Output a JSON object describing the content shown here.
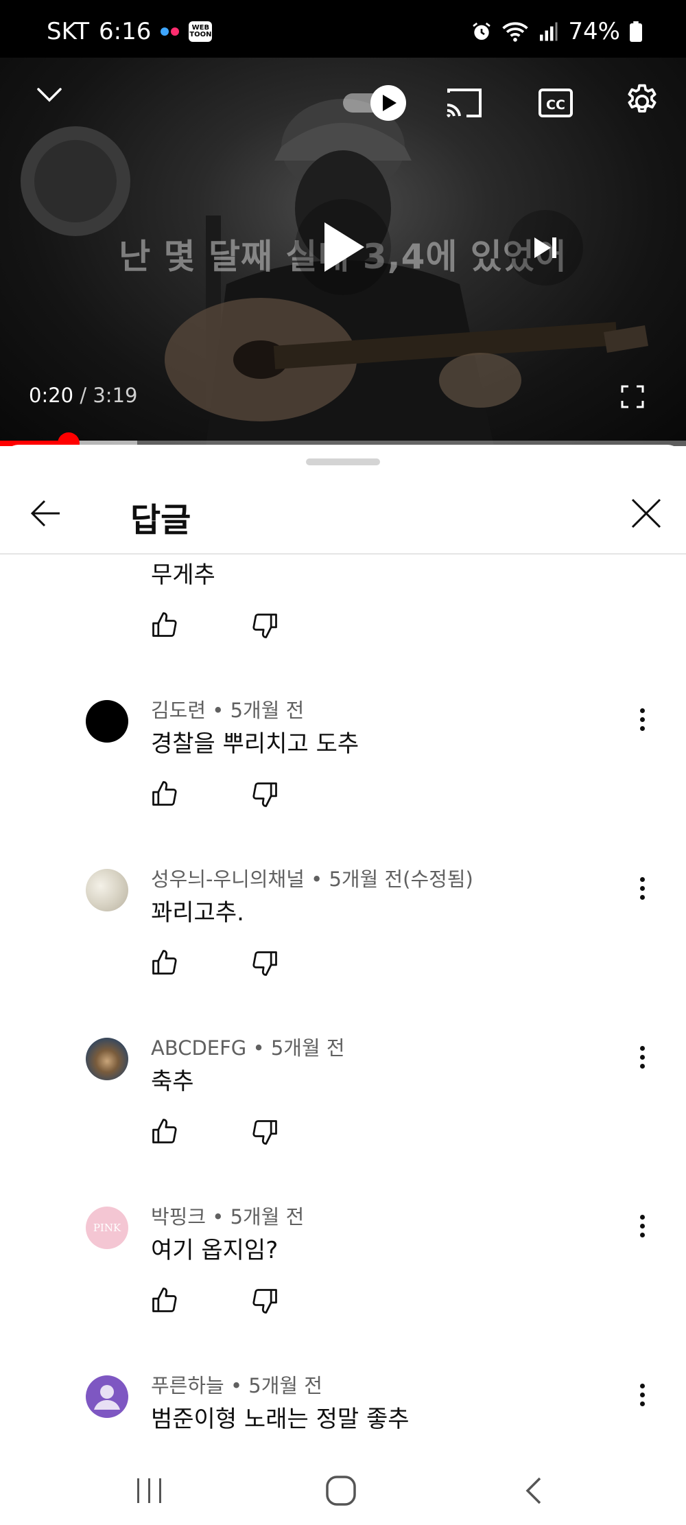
{
  "status_bar": {
    "carrier": "SKT",
    "time": "6:16",
    "battery": "74%",
    "icons": [
      "dual-dot-icon",
      "webtoon-icon",
      "alarm-icon",
      "wifi-icon",
      "signal-icon",
      "battery-icon"
    ],
    "webtoon_badge": "WEB TOON"
  },
  "player": {
    "lyric_caption": "난 몇 달째 실내 3,4에 있었어",
    "current_time": "0:20",
    "separator": " / ",
    "duration": "3:19",
    "progress_fraction": 0.1,
    "buffered_fraction": 0.2,
    "autoplay_on": true,
    "icons": [
      "chevron-down-icon",
      "autoplay-toggle-icon",
      "cast-icon",
      "closed-captions-icon",
      "settings-gear-icon",
      "play-icon",
      "skip-next-icon",
      "fullscreen-icon"
    ],
    "accent_color": "#ff0000"
  },
  "panel": {
    "title": "답글",
    "partial_reply_text": "무게추"
  },
  "replies": [
    {
      "author": "김도련",
      "age": "5개월 전",
      "text": "경찰을 뿌리치고 도추",
      "avatar": "black-circle"
    },
    {
      "author": "성우늬-우니의채널",
      "age": "5개월 전(수정됨)",
      "text": "꽈리고추.",
      "avatar": "marble"
    },
    {
      "author": "ABCDEFG",
      "age": "5개월 전",
      "text": "축추",
      "avatar": "illustration"
    },
    {
      "author": "박핑크",
      "age": "5개월 전",
      "text": "여기 옵지임?",
      "avatar": "pink",
      "avatar_text": "PINK"
    },
    {
      "author": "푸른하늘",
      "age": "5개월 전",
      "text": "범준이형 노래는 정말 좋추",
      "avatar": "default-purple"
    }
  ],
  "meta_separator": " • ",
  "nav_icons": [
    "recent-apps-icon",
    "home-icon",
    "back-icon"
  ]
}
